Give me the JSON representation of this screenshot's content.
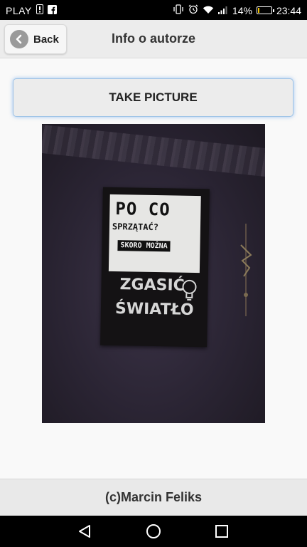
{
  "status_bar": {
    "carrier": "PLAY",
    "battery_percent": "14%",
    "battery_level": 0.14,
    "time": "23:44",
    "icons": [
      "alert-icon",
      "facebook-icon",
      "vibrate-icon",
      "alarm-icon",
      "wifi-icon",
      "signal-icon",
      "battery-icon"
    ]
  },
  "header": {
    "back_label": "Back",
    "title": "Info o autorze"
  },
  "main": {
    "take_picture_label": "TAKE PICTURE",
    "photo": {
      "line1": "PO CO",
      "line2": "SPRZĄTAĆ?",
      "line3": "SKORO MOŻNA",
      "line4": "ZGASIĆ",
      "line5": "ŚWIATŁO"
    }
  },
  "footer": {
    "text": "(c)Marcin Feliks"
  },
  "nav_bar": {
    "icons": [
      "back-triangle-icon",
      "home-circle-icon",
      "recents-square-icon"
    ]
  },
  "colors": {
    "status_bar": "#000000",
    "header_bg": "#ececec",
    "button_focus_glow": "#9ec3e6",
    "battery_fill": "#f3c400"
  }
}
